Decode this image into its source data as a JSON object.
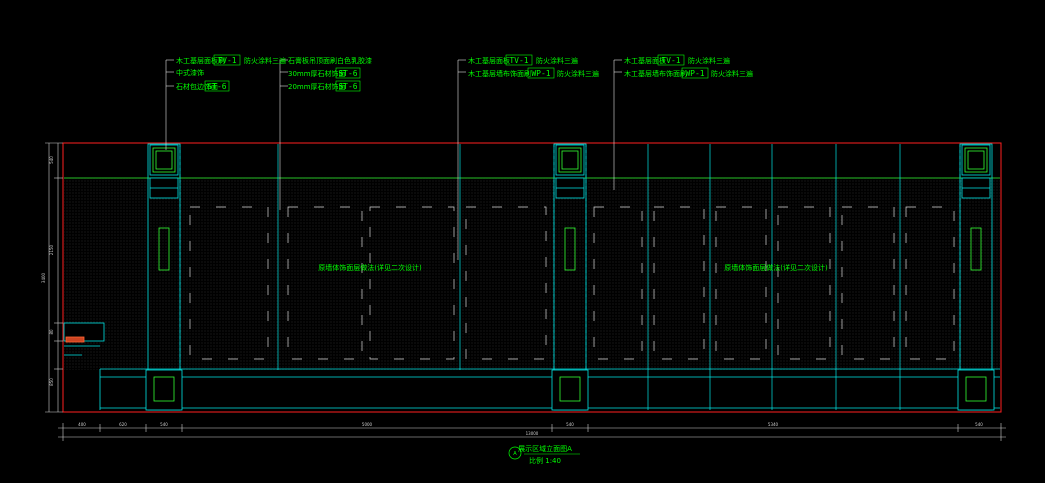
{
  "annotations": {
    "group1": {
      "line1": {
        "prefix": "木工基层面板刷",
        "tag": "TV-1",
        "suffix": "防火涂料三遍"
      },
      "line2": {
        "text": "中式漆饰"
      },
      "line3": {
        "prefix": "石材包边饰面",
        "tag": "ST-6"
      }
    },
    "group2": {
      "line1": {
        "text": "石膏板吊顶面刷白色乳胶漆"
      },
      "line2": {
        "prefix": "30mm厚石材饰面",
        "tag": "ST-6"
      },
      "line3": {
        "prefix": "20mm厚石材饰面",
        "tag": "ST-6"
      }
    },
    "group3": {
      "line1": {
        "prefix": "木工基层面板",
        "tag": "TV-1",
        "suffix": "防火涂料三遍"
      },
      "line2": {
        "prefix": "木工基层墙布饰面刷",
        "tag": "WP-1",
        "suffix": "防火涂料三遍"
      }
    },
    "group4": {
      "line1": {
        "prefix": "木工基层面板",
        "tag": "TV-1",
        "suffix": "防火涂料三遍"
      },
      "line2": {
        "prefix": "木工基层墙布饰面刷",
        "tag": "WP-1",
        "suffix": "防火涂料三遍"
      }
    }
  },
  "panels": {
    "left_note": "原墙体饰面层做法(详见二次设计)",
    "right_note": "原墙体饰面层做法(详见二次设计)"
  },
  "dimensions": {
    "horizontal": [
      "400",
      "620",
      "540",
      "5000",
      "540",
      "5340",
      "540"
    ],
    "overall": "13000",
    "vertical": [
      "540",
      "2150",
      "3400",
      "80",
      "850"
    ]
  },
  "title": {
    "marker": "A",
    "name": "展示区域立面图A",
    "scale": "比例 1:40"
  },
  "colors": {
    "background": "#000000",
    "frame": "#ff2020",
    "structure": "#00e5e5",
    "annotation": "#00ff00",
    "dimension": "#cfcfcf"
  }
}
